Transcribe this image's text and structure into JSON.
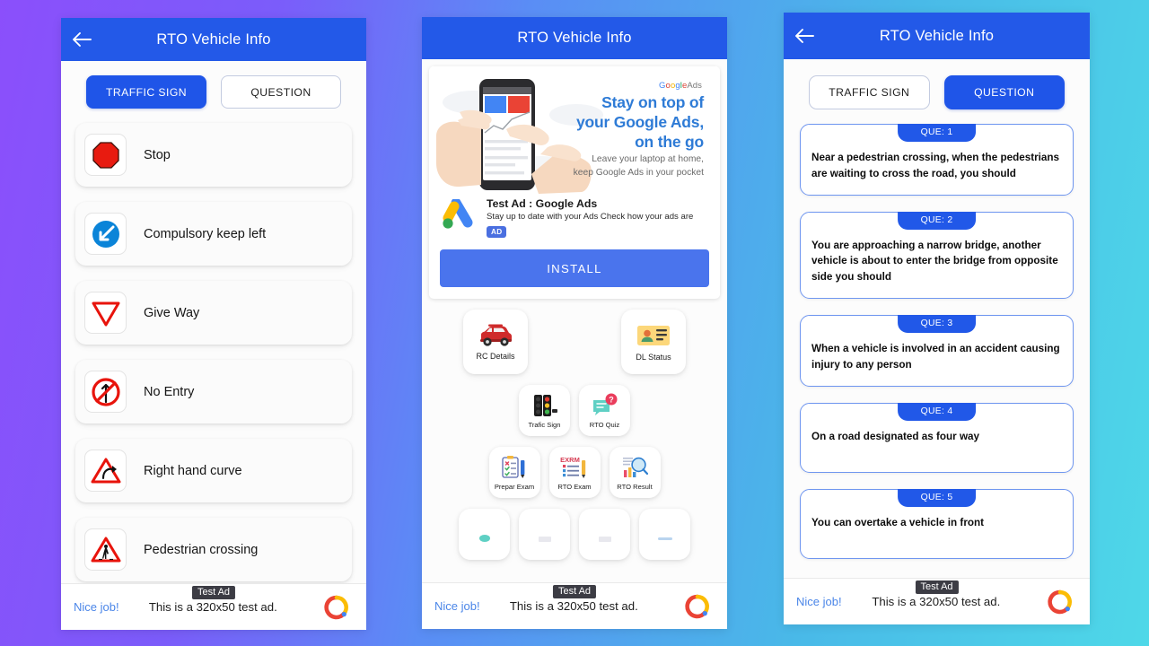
{
  "background": {
    "from": "#8b4ffb",
    "to": "#4ed8e8"
  },
  "theme": {
    "primary": "#2359e8",
    "accent_blue": "#1f55e8",
    "card_border": "#6f96f0"
  },
  "panels": {
    "traffic_sign": {
      "appbar": {
        "title": "RTO Vehicle Info",
        "back_icon": "arrow-left-icon"
      },
      "tabs": [
        {
          "label": "TRAFFIC SIGN",
          "active": true
        },
        {
          "label": "QUESTION",
          "active": false
        }
      ],
      "signs": [
        {
          "label": "Stop",
          "icon": "stop-sign-icon"
        },
        {
          "label": "Compulsory keep left",
          "icon": "compulsory-keep-left-icon"
        },
        {
          "label": "Give Way",
          "icon": "give-way-icon"
        },
        {
          "label": "No Entry",
          "icon": "no-entry-icon"
        },
        {
          "label": "Right hand curve",
          "icon": "right-hand-curve-icon"
        },
        {
          "label": "Pedestrian crossing",
          "icon": "pedestrian-crossing-icon"
        }
      ],
      "adbar": {
        "cta": "Nice job!",
        "text": "This is a 320x50 test ad.",
        "tag": "Test Ad",
        "logo": "admob-icon"
      }
    },
    "home": {
      "appbar": {
        "title": "RTO Vehicle Info"
      },
      "ad": {
        "brand_logo_letters": [
          "G",
          "o",
          "o",
          "g",
          "l",
          "e"
        ],
        "brand_word": "Ads",
        "headline_lines": [
          "Stay on top of",
          "your Google Ads,",
          "on the go"
        ],
        "subtitle_lines": [
          "Leave your laptop at home,",
          "keep Google Ads in your pocket"
        ],
        "app_title": "Test Ad : Google Ads",
        "app_desc": "Stay up to date with your Ads Check how your ads are",
        "badge": "AD",
        "install_label": "INSTALL",
        "app_icon": "google-ads-icon",
        "banner_art": "hand-holding-phone-illustration"
      },
      "grid": [
        [
          {
            "label": "RC Details",
            "icon": "car-icon"
          },
          {
            "label": "DL Status",
            "icon": "id-card-icon"
          }
        ],
        [
          {
            "label": "Trafic Sign",
            "icon": "traffic-light-icon"
          },
          {
            "label": "RTO Quiz",
            "icon": "quiz-bubble-icon"
          }
        ],
        [
          {
            "label": "Prepar Exam",
            "icon": "clipboard-pencil-icon"
          },
          {
            "label": "RTO Exam",
            "icon": "exam-paper-icon"
          },
          {
            "label": "RTO Result",
            "icon": "result-magnifier-icon"
          }
        ]
      ],
      "adbar": {
        "cta": "Nice job!",
        "text": "This is a 320x50 test ad.",
        "tag": "Test Ad",
        "logo": "admob-icon"
      }
    },
    "question": {
      "appbar": {
        "title": "RTO Vehicle Info",
        "back_icon": "arrow-left-icon"
      },
      "tabs": [
        {
          "label": "TRAFFIC SIGN",
          "active": false
        },
        {
          "label": "QUESTION",
          "active": true
        }
      ],
      "questions": [
        {
          "badge": "QUE: 1",
          "text": "Near a pedestrian crossing, when the pedestrians are waiting to cross the road, you should"
        },
        {
          "badge": "QUE: 2",
          "text": "You are approaching a narrow bridge, another vehicle is about to enter the bridge from opposite side you should"
        },
        {
          "badge": "QUE: 3",
          "text": "When a vehicle is involved in an accident causing injury to any person"
        },
        {
          "badge": "QUE: 4",
          "text": "On a road designated as four way"
        },
        {
          "badge": "QUE: 5",
          "text": "You can overtake a vehicle in front"
        }
      ],
      "adbar": {
        "cta": "Nice job!",
        "text": "This is a 320x50 test ad.",
        "tag": "Test Ad",
        "logo": "admob-icon"
      }
    }
  }
}
